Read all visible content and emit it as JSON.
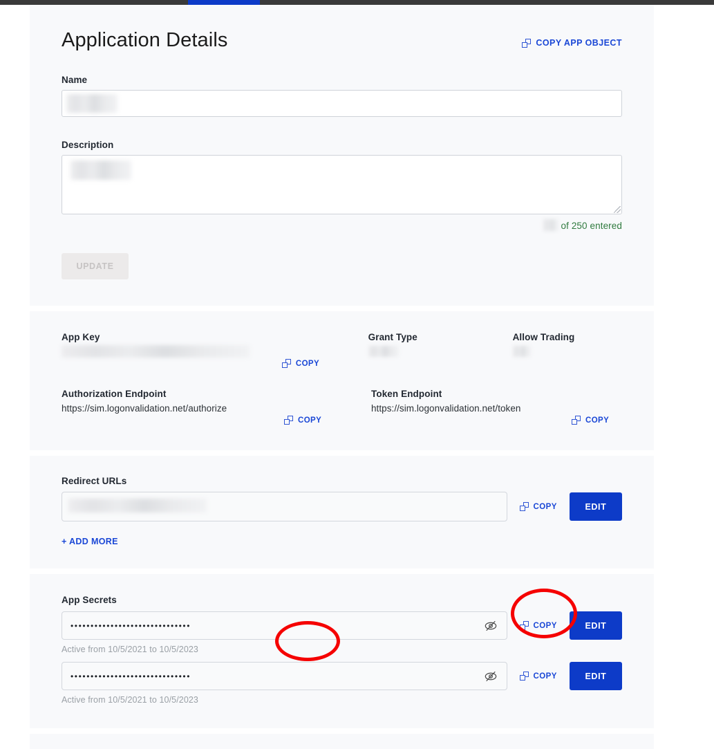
{
  "topbar": {
    "accent_color": "#0d3bc8",
    "bar_color": "#3a3a3a"
  },
  "header": {
    "title": "Application Details",
    "copy_app_object_label": "COPY APP OBJECT",
    "copy_icon": "copy-icon"
  },
  "form": {
    "name_label": "Name",
    "name_value": "",
    "description_label": "Description",
    "description_value": "",
    "counter_suffix": "of 250 entered",
    "update_label": "UPDATE"
  },
  "keys": {
    "app_key_label": "App Key",
    "app_key_value": "",
    "app_key_copy_label": "COPY",
    "grant_type_label": "Grant Type",
    "grant_type_value": "",
    "allow_trading_label": "Allow Trading",
    "allow_trading_value": "",
    "authorization_endpoint_label": "Authorization Endpoint",
    "authorization_endpoint_value": "https://sim.logonvalidation.net/authorize",
    "authorization_copy_label": "COPY",
    "token_endpoint_label": "Token Endpoint",
    "token_endpoint_value": "https://sim.logonvalidation.net/token",
    "token_copy_label": "COPY"
  },
  "redirect": {
    "title": "Redirect URLs",
    "url_value": "",
    "copy_label": "COPY",
    "edit_label": "EDIT",
    "add_more_label": "+ ADD MORE"
  },
  "secrets": {
    "title": "App Secrets",
    "items": [
      {
        "masked_value": "••••••••••••••••••••••••••••••",
        "active_from": "Active from 10/5/2021 to 10/5/2023",
        "copy_label": "COPY",
        "edit_label": "EDIT",
        "toggle_icon": "eye-slash-icon"
      },
      {
        "masked_value": "••••••••••••••••••••••••••••••",
        "active_from": "Active from 10/5/2021 to 10/5/2023",
        "copy_label": "COPY",
        "edit_label": "EDIT",
        "toggle_icon": "eye-slash-icon"
      }
    ]
  },
  "annotations": {
    "color": "#f50000",
    "circles": [
      {
        "target": "app-key-copy-button"
      },
      {
        "target": "app-secret-1-copy-button"
      }
    ]
  }
}
